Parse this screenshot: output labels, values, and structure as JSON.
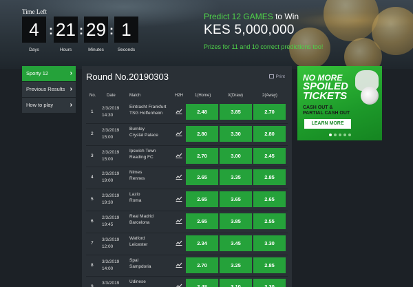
{
  "countdown": {
    "label": "Time Left",
    "days": "4",
    "hours": "21",
    "minutes": "29",
    "seconds": "1",
    "days_label": "Days",
    "hours_label": "Hours",
    "minutes_label": "Minutes",
    "seconds_label": "Seconds"
  },
  "promo": {
    "headline_green": "Predict 12 GAMES",
    "headline_white": "to Win",
    "amount": "KES 5,000,000",
    "sub": "Prizes for 11 and 10 correct predictions too!"
  },
  "nav": {
    "items": [
      {
        "label": "Sporty 12"
      },
      {
        "label": "Previous Results"
      },
      {
        "label": "How to play"
      }
    ]
  },
  "round": {
    "title": "Round No.20190303",
    "print_label": "Print"
  },
  "table": {
    "headers": {
      "no": "No.",
      "date": "Date",
      "match": "Match",
      "h2h": "H2H",
      "home": "1(Home)",
      "draw": "X(Draw)",
      "away": "2(Away)"
    },
    "rows": [
      {
        "no": "1",
        "date": "2/3/2019",
        "time": "14:30",
        "home": "Eintracht Frankfurt",
        "away": "TSG Hoffenheim",
        "o1": "2.48",
        "ox": "3.85",
        "o2": "2.70"
      },
      {
        "no": "2",
        "date": "2/3/2019",
        "time": "15:00",
        "home": "Burnley",
        "away": "Crystal Palace",
        "o1": "2.80",
        "ox": "3.30",
        "o2": "2.80"
      },
      {
        "no": "3",
        "date": "2/3/2019",
        "time": "15:00",
        "home": "Ipswich Town",
        "away": "Reading FC",
        "o1": "2.70",
        "ox": "3.00",
        "o2": "2.45"
      },
      {
        "no": "4",
        "date": "2/3/2019",
        "time": "19:00",
        "home": "Nimes",
        "away": "Rennes",
        "o1": "2.65",
        "ox": "3.35",
        "o2": "2.85"
      },
      {
        "no": "5",
        "date": "2/3/2019",
        "time": "19:30",
        "home": "Lazio",
        "away": "Roma",
        "o1": "2.65",
        "ox": "3.65",
        "o2": "2.65"
      },
      {
        "no": "6",
        "date": "2/3/2019",
        "time": "19:45",
        "home": "Real Madrid",
        "away": "Barcelona",
        "o1": "2.65",
        "ox": "3.85",
        "o2": "2.55"
      },
      {
        "no": "7",
        "date": "3/3/2019",
        "time": "12:00",
        "home": "Watford",
        "away": "Leicester",
        "o1": "2.34",
        "ox": "3.45",
        "o2": "3.30"
      },
      {
        "no": "8",
        "date": "3/3/2019",
        "time": "14:00",
        "home": "Spal",
        "away": "Sampdoria",
        "o1": "2.70",
        "ox": "3.25",
        "o2": "2.85"
      },
      {
        "no": "9",
        "date": "3/3/2019",
        "time": "",
        "home": "Udinese",
        "away": "",
        "o1": "2.48",
        "ox": "3.10",
        "o2": "3.30"
      }
    ]
  },
  "ad": {
    "line1": "NO MORE",
    "line2": "SPOILED",
    "line3": "TICKETS",
    "sub1": "CASH OUT &",
    "sub2": "PARTIAL CASH OUT",
    "button": "LEARN MORE"
  }
}
